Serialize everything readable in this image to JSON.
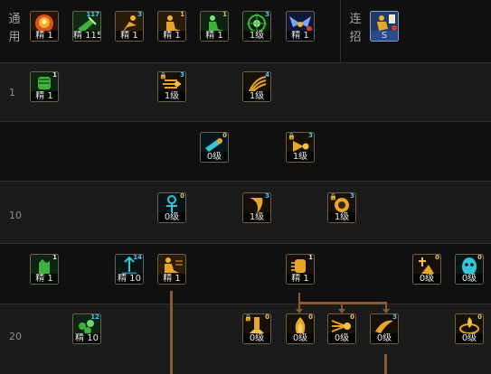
{
  "sidebar": {
    "common_label_1": "通",
    "common_label_2": "用",
    "combo_label_1": "连",
    "combo_label_2": "招"
  },
  "rows": {
    "r1": "1",
    "r10": "10",
    "r20": "20"
  },
  "common_skills": [
    {
      "icon": "flame-burst-icon",
      "count": "",
      "level": "精 1"
    },
    {
      "icon": "green-strike-icon",
      "count": "117",
      "level": "精 115"
    },
    {
      "icon": "gold-leap-icon",
      "count": "3",
      "level": "精 1"
    },
    {
      "icon": "gold-sit-icon",
      "count": "1",
      "level": "精 1"
    },
    {
      "icon": "green-sit-icon",
      "count": "1",
      "level": "精 1"
    },
    {
      "icon": "green-target-icon",
      "count": "3",
      "level": "1级"
    },
    {
      "icon": "blue-wings-icon",
      "count": "",
      "level": "精 1"
    }
  ],
  "combo": {
    "icon": "combo-scroll-icon",
    "level": "S"
  },
  "tree": [
    {
      "id": "a1",
      "icon": "green-fist-icon",
      "count": "1",
      "level": "精 1",
      "locked": false
    },
    {
      "id": "a2",
      "icon": "gold-rush-icon",
      "count": "3",
      "level": "1级",
      "locked": true
    },
    {
      "id": "a3",
      "icon": "gold-claw-icon",
      "count": "4",
      "level": "1级",
      "locked": false
    },
    {
      "id": "b1",
      "icon": "cyan-dash-icon",
      "count": "0",
      "level": "0级",
      "locked": false
    },
    {
      "id": "b2",
      "icon": "gold-dash-icon",
      "count": "3",
      "level": "1级",
      "locked": true
    },
    {
      "id": "c1",
      "icon": "ankh-icon",
      "count": "0",
      "level": "0级",
      "locked": false
    },
    {
      "id": "c2",
      "icon": "gold-wave-icon",
      "count": "3",
      "level": "1级",
      "locked": false
    },
    {
      "id": "c3",
      "icon": "gold-orb-icon",
      "count": "3",
      "level": "1级",
      "locked": true
    },
    {
      "id": "d1",
      "icon": "green-glove-icon",
      "count": "1",
      "level": "精 1",
      "locked": false
    },
    {
      "id": "d2",
      "icon": "teal-strike-icon",
      "count": "14",
      "level": "精 10",
      "locked": false
    },
    {
      "id": "d3",
      "icon": "gold-stride-icon",
      "count": "",
      "level": "精 1",
      "locked": false
    },
    {
      "id": "d4",
      "icon": "gold-fist-icon",
      "count": "1",
      "level": "精 1",
      "locked": false
    },
    {
      "id": "d5",
      "icon": "gold-cross-icon",
      "count": "0",
      "level": "0级",
      "locked": false
    },
    {
      "id": "d6",
      "icon": "teal-mask-icon",
      "count": "0",
      "level": "0级",
      "locked": false
    },
    {
      "id": "e1",
      "icon": "green-crystal-icon",
      "count": "12",
      "level": "精 10",
      "locked": false
    },
    {
      "id": "e2",
      "icon": "gold-pillar-icon",
      "count": "0",
      "level": "0级",
      "locked": true
    },
    {
      "id": "e3",
      "icon": "gold-flame-icon",
      "count": "0",
      "level": "0级",
      "locked": false
    },
    {
      "id": "e4",
      "icon": "gold-beams-icon",
      "count": "0",
      "level": "0级",
      "locked": false
    },
    {
      "id": "e5",
      "icon": "gold-swipe-icon",
      "count": "3",
      "level": "0级",
      "locked": false
    },
    {
      "id": "e6",
      "icon": "gold-ring-icon",
      "count": "0",
      "level": "0级",
      "locked": false
    }
  ],
  "colors": {
    "gold": "#e8a628",
    "green": "#3fb13f",
    "cyan": "#35c6d8",
    "connector": "#8a5a30"
  }
}
